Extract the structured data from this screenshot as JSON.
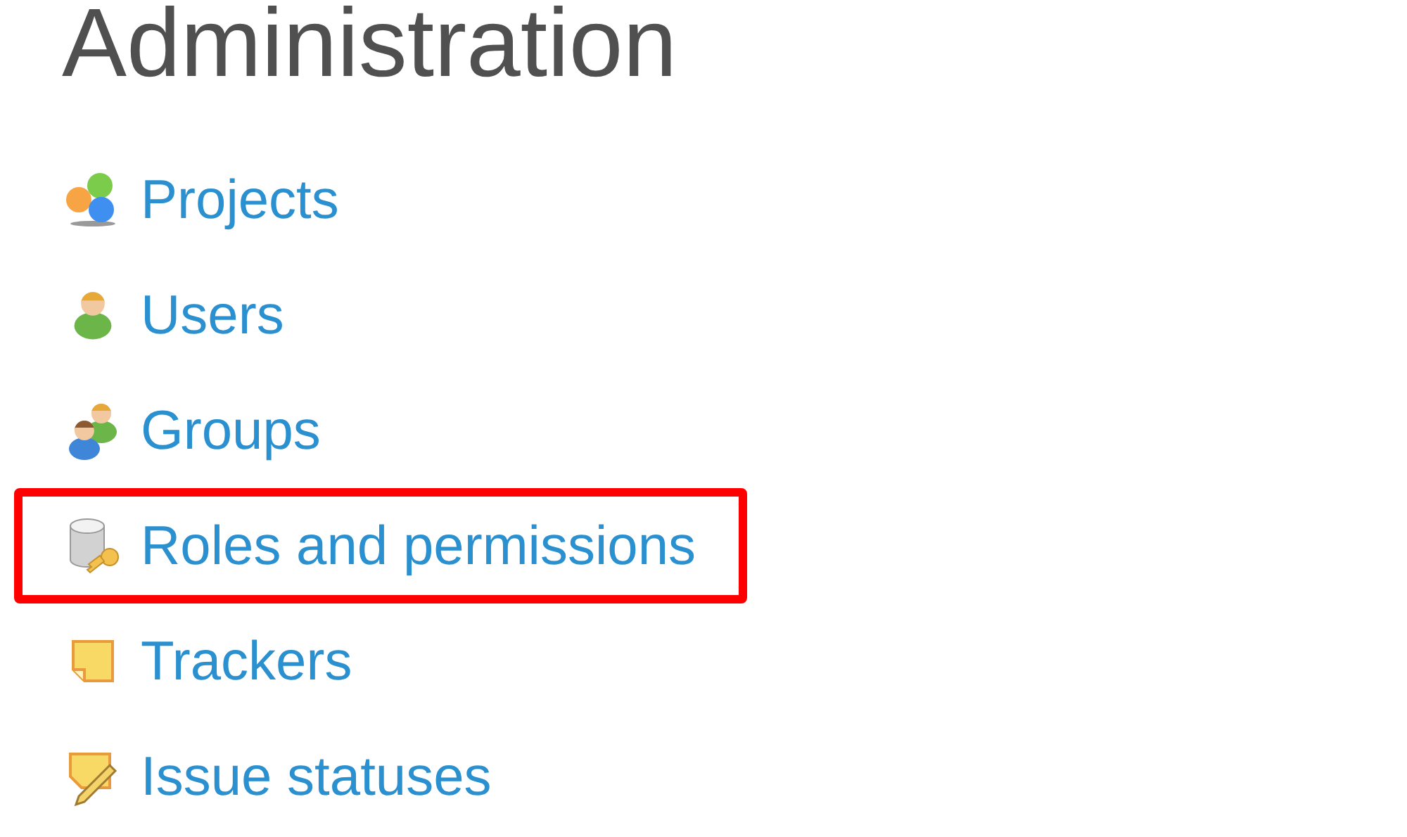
{
  "title": "Administration",
  "items": [
    {
      "label": "Projects",
      "kind": "projects",
      "highlighted": false
    },
    {
      "label": "Users",
      "kind": "user",
      "highlighted": false
    },
    {
      "label": "Groups",
      "kind": "group",
      "highlighted": false
    },
    {
      "label": "Roles and permissions",
      "kind": "roles",
      "highlighted": true
    },
    {
      "label": "Trackers",
      "kind": "tracker",
      "highlighted": false
    },
    {
      "label": "Issue statuses",
      "kind": "status",
      "highlighted": false
    }
  ]
}
